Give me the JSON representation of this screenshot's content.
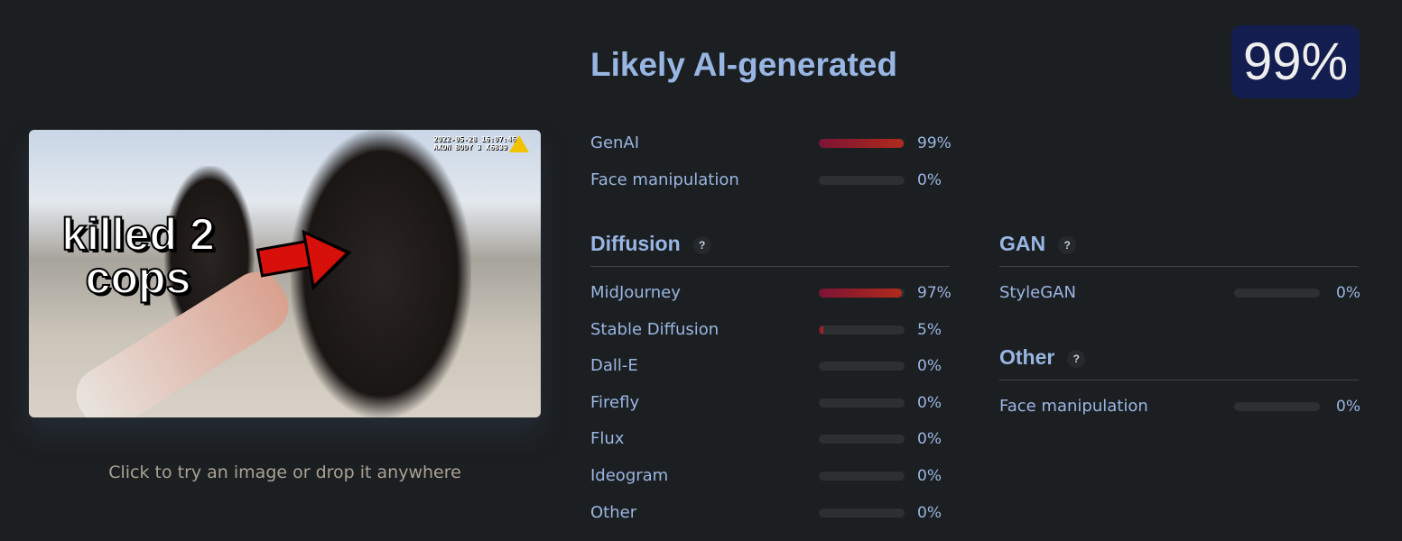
{
  "upload": {
    "caption_line1": "killed 2",
    "caption_line2": "cops",
    "stamp_line1": "2022-05-28 16:07:46",
    "stamp_line2": "AXON BODY 3 X6839",
    "hint": "Click to try an image or drop it anywhere"
  },
  "verdict": {
    "title": "Likely AI-generated",
    "score": "99%",
    "badge_color": "#141d4f"
  },
  "summary": [
    {
      "label": "GenAI",
      "value": "99%",
      "fraction": 0.99
    },
    {
      "label": "Face manipulation",
      "value": "0%",
      "fraction": 0
    }
  ],
  "diffusion": {
    "title": "Diffusion",
    "help": "?",
    "items": [
      {
        "label": "MidJourney",
        "value": "97%",
        "fraction": 0.97
      },
      {
        "label": "Stable Diffusion",
        "value": "5%",
        "fraction": 0.05
      },
      {
        "label": "Dall-E",
        "value": "0%",
        "fraction": 0
      },
      {
        "label": "Firefly",
        "value": "0%",
        "fraction": 0
      },
      {
        "label": "Flux",
        "value": "0%",
        "fraction": 0
      },
      {
        "label": "Ideogram",
        "value": "0%",
        "fraction": 0
      },
      {
        "label": "Other",
        "value": "0%",
        "fraction": 0
      }
    ]
  },
  "gan": {
    "title": "GAN",
    "help": "?",
    "items": [
      {
        "label": "StyleGAN",
        "value": "0%",
        "fraction": 0
      }
    ]
  },
  "other": {
    "title": "Other",
    "help": "?",
    "items": [
      {
        "label": "Face manipulation",
        "value": "0%",
        "fraction": 0
      }
    ]
  },
  "colors": {
    "bar_start": "#7c1435",
    "bar_end": "#b02a1c",
    "track": "#2c3033"
  }
}
